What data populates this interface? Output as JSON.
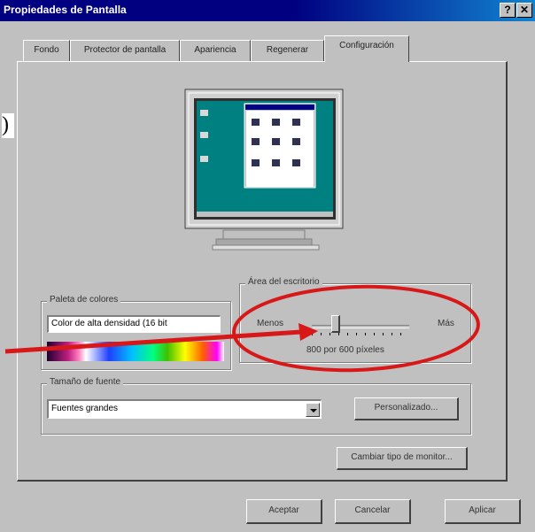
{
  "window": {
    "title": "Propiedades de Pantalla",
    "help_glyph": "?",
    "close_glyph": "✕"
  },
  "tabs": [
    {
      "label": "Fondo"
    },
    {
      "label": "Protector de pantalla"
    },
    {
      "label": "Apariencia"
    },
    {
      "label": "Regenerar"
    },
    {
      "label": "Configuración"
    }
  ],
  "edge_mark": ")",
  "palette": {
    "label": "Paleta de colores",
    "value": "Color de alta densidad (16 bit"
  },
  "desktop_area": {
    "label": "Área del escritorio",
    "less": "Menos",
    "more": "Más",
    "resolution": "800 por 600 píxeles",
    "level": 0.22
  },
  "font_size": {
    "label": "Tamaño de fuente",
    "value": "Fuentes grandes",
    "custom_button": "Personalizado..."
  },
  "change_monitor_button": "Cambiar tipo de monitor...",
  "footer": {
    "ok": "Aceptar",
    "cancel": "Cancelar",
    "apply": "Aplicar"
  },
  "colors": {
    "title_bar": "#000080",
    "dialog_bg": "#c0c0c0",
    "desktop_teal": "#008080",
    "annotation_red": "#d81818"
  }
}
